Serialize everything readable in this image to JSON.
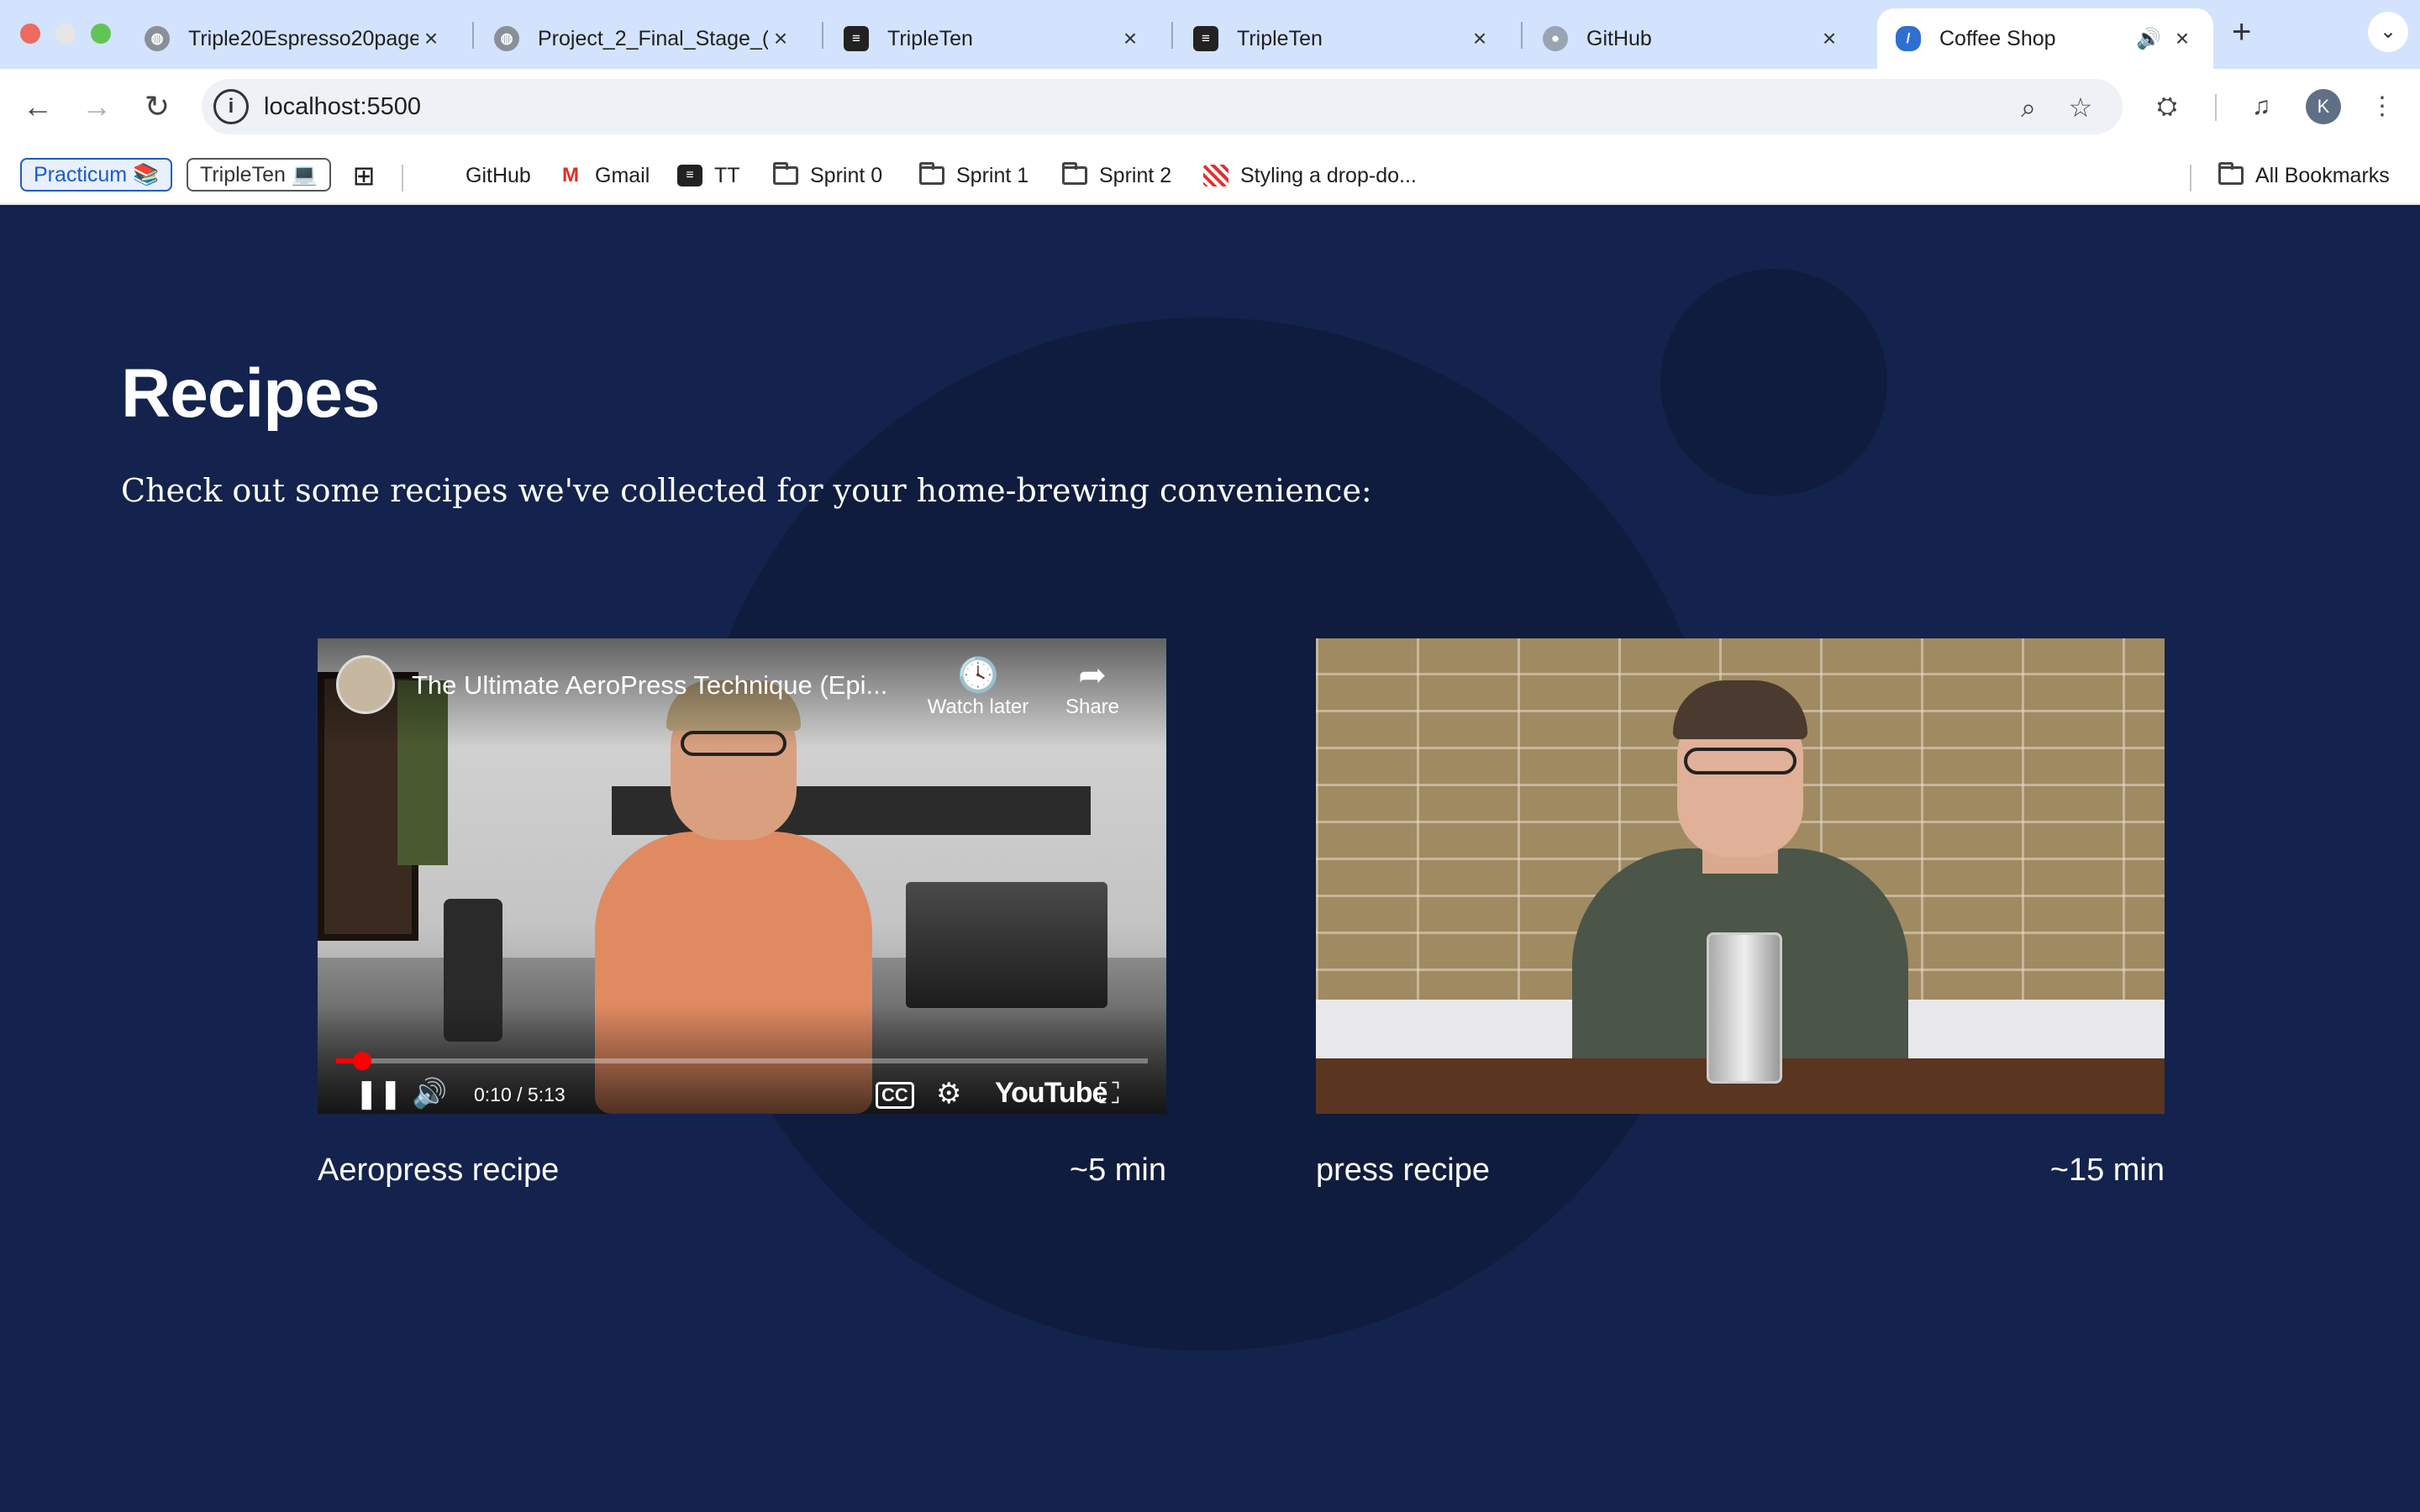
{
  "browser": {
    "tabs": [
      {
        "title": "Triple20Espresso20page",
        "favicon": "globe-icon"
      },
      {
        "title": "Project_2_Final_Stage_(",
        "favicon": "globe-icon"
      },
      {
        "title": "TripleTen",
        "favicon": "tripleten-icon"
      },
      {
        "title": "TripleTen",
        "favicon": "tripleten-icon"
      },
      {
        "title": "GitHub",
        "favicon": "github-icon"
      },
      {
        "title": "Coffee Shop",
        "favicon": "coffee-bean-icon",
        "active": true
      }
    ],
    "new_tab_label": "+",
    "url": "localhost:5500",
    "profile_initial": "K",
    "bookmarks": {
      "practicum": "Practicum 📚",
      "tripleten": "TripleTen 💻",
      "items": [
        "GitHub",
        "Gmail",
        "TT",
        "Sprint 0",
        "Sprint 1",
        "Sprint 2",
        "Styling a drop-do..."
      ],
      "all_bookmarks": "All Bookmarks"
    }
  },
  "page": {
    "heading": "Recipes",
    "subheading": "Check out some recipes we've collected for your home-brewing convenience:",
    "recipes": [
      {
        "name": "Aeropress recipe",
        "duration": "~5 min",
        "video": {
          "title": "The Ultimate AeroPress Technique (Epi...",
          "watch_later": "Watch later",
          "share": "Share",
          "time": "0:10 / 5:13",
          "progress_fraction": 0.032,
          "brand": "YouTube",
          "cc": "CC"
        }
      },
      {
        "name": "press recipe",
        "duration": "~15 min"
      }
    ]
  },
  "colors": {
    "page_background": "#13234d",
    "circle": "#0f1c3e",
    "tabstrip": "#d3e3fd",
    "progress": "#ff0000"
  }
}
